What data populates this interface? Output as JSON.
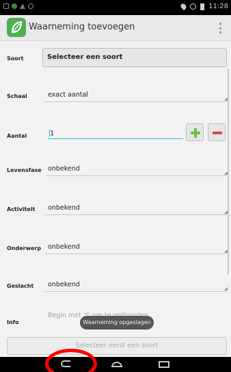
{
  "status_bar": {
    "time": "11:28",
    "icons": [
      "gallery-icon",
      "android-icon",
      "warning-icon",
      "circle-icon",
      "location-icon",
      "sync-icon",
      "battery-icon"
    ]
  },
  "action_bar": {
    "title": "Waarneming toevoegen",
    "logo_icon": "leaf-logo-icon",
    "overflow_icon": "overflow-menu-icon"
  },
  "form": {
    "soort": {
      "label": "Soort",
      "button": "Selecteer een soort"
    },
    "schaal": {
      "label": "Schaal",
      "value": "exact aantal"
    },
    "aantal": {
      "label": "Aantal",
      "value": "1"
    },
    "levensfase": {
      "label": "Levensfase",
      "value": "onbekend"
    },
    "activiteit": {
      "label": "Activiteit",
      "value": "onbekend"
    },
    "onderwerp": {
      "label": "Onderwerp",
      "value": "onbekend"
    },
    "geslacht": {
      "label": "Geslacht",
      "value": "onbekend"
    },
    "info": {
      "label": "Info",
      "placeholder": "Begin met '*' om te onthouden"
    }
  },
  "toast": "Waarneming opgeslagen",
  "submit_button": "Selecteer eerst een soort",
  "colors": {
    "accent": "#33b5e5",
    "plus": "#6cc04a",
    "minus": "#e04444",
    "logo": "#4caf50",
    "annotation": "#ff0000"
  },
  "nav_bar": {
    "icons": [
      "back-icon",
      "home-icon",
      "recent-apps-icon"
    ]
  }
}
